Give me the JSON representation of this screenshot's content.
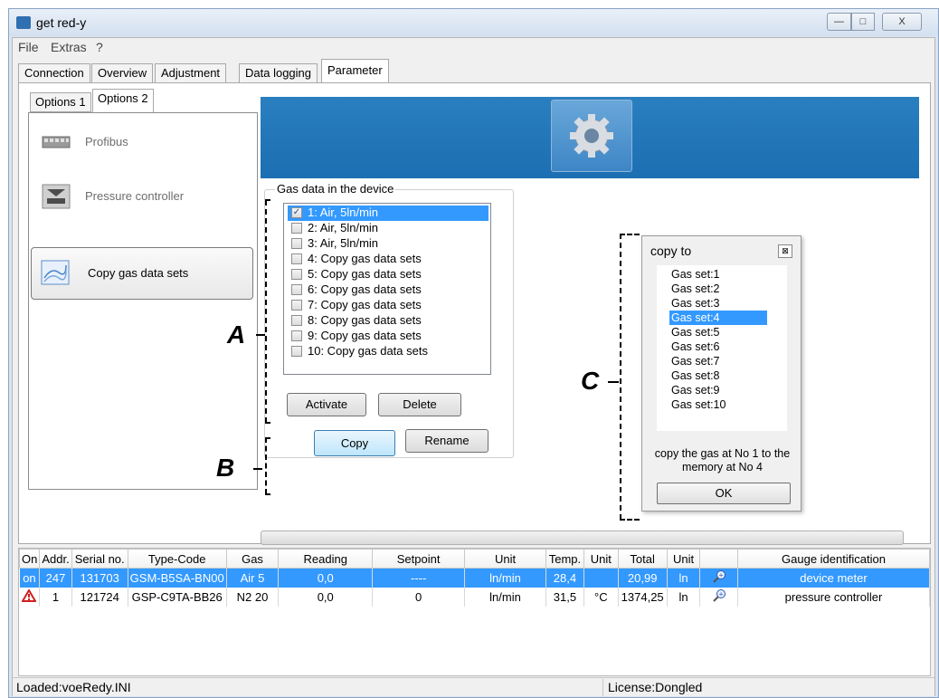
{
  "window": {
    "title": "get red-y",
    "min": "—",
    "max": "□",
    "close": "X"
  },
  "menu": {
    "items": [
      "File",
      "Extras",
      "?"
    ]
  },
  "tabs": [
    "Connection",
    "Overview",
    "Adjustment",
    "Data logging",
    "Parameter"
  ],
  "subtabs": [
    "Options 1",
    "Options 2"
  ],
  "options": [
    {
      "label": "Profibus",
      "icon": "profibus-icon"
    },
    {
      "label": "Pressure controller",
      "icon": "pressure-controller-icon"
    },
    {
      "label": "Copy gas data sets",
      "icon": "copy-gas-data-icon"
    }
  ],
  "gas_group": {
    "title": "Gas data in the device",
    "items": [
      "1: Air, 5ln/min",
      "2: Air, 5ln/min",
      "3: Air, 5ln/min",
      "4: Copy gas data sets",
      "5: Copy gas data sets",
      "6: Copy gas data sets",
      "7: Copy gas data sets",
      "8: Copy gas data sets",
      "9: Copy gas data sets",
      "10: Copy gas data sets"
    ],
    "checked_index": 0,
    "buttons": {
      "activate": "Activate",
      "delete": "Delete",
      "copy": "Copy",
      "rename": "Rename"
    }
  },
  "copy_dialog": {
    "title": "copy to",
    "close": "⊠",
    "items": [
      "Gas set:1",
      "Gas set:2",
      "Gas set:3",
      "Gas set:4",
      "Gas set:5",
      "Gas set:6",
      "Gas set:7",
      "Gas set:8",
      "Gas set:9",
      "Gas set:10"
    ],
    "selected_index": 3,
    "message": "copy the gas at No 1 to the memory at No 4",
    "ok": "OK"
  },
  "annotations": {
    "a": "A",
    "b": "B",
    "c": "C"
  },
  "table": {
    "headers": [
      "On",
      "Addr.",
      "Serial no.",
      "Type-Code",
      "Gas",
      "Reading",
      "Setpoint",
      "Unit",
      "Temp.",
      "Unit",
      "Total",
      "Unit",
      "",
      "Gauge identification"
    ],
    "rows": [
      [
        "on",
        "247",
        "131703",
        "GSM-B5SA-BN00",
        "Air 5",
        "0,0",
        "----",
        "ln/min",
        "28,4",
        "",
        "20,99",
        "ln",
        "zoom-icon",
        "device meter"
      ],
      [
        "warning-icon",
        "1",
        "121724",
        "GSP-C9TA-BB26",
        "N2 20",
        "0,0",
        "0",
        "ln/min",
        "31,5",
        "°C",
        "1374,25",
        "ln",
        "zoom-icon",
        "pressure controller"
      ]
    ]
  },
  "status": {
    "left": "Loaded:voeRedy.INI",
    "right": "License:Dongled"
  },
  "colors": {
    "selection": "#3399ff",
    "banner": "#1b6fb2"
  }
}
